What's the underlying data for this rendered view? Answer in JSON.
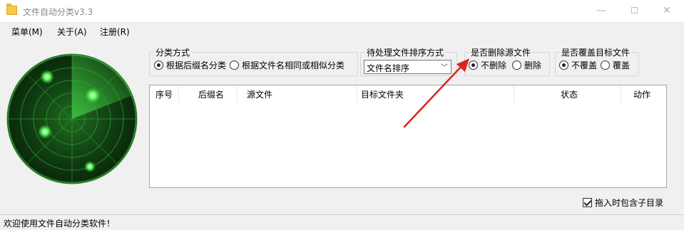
{
  "window": {
    "title": "文件自动分类v3.3",
    "controls": {
      "minimize": "—",
      "close": "✕"
    }
  },
  "menubar": {
    "items": [
      {
        "label": "菜单(M)"
      },
      {
        "label": "关于(A)"
      },
      {
        "label": "注册(R)"
      }
    ]
  },
  "classify": {
    "legend": "分类方式",
    "options": [
      {
        "label": "根据后缀名分类",
        "selected": true
      },
      {
        "label": "根据文件名相同或相似分类",
        "selected": false
      }
    ]
  },
  "sort": {
    "legend": "待处理文件排序方式",
    "selected": "文件名排序"
  },
  "delete_source": {
    "legend": "是否删除源文件",
    "options": [
      {
        "label": "不删除",
        "selected": true
      },
      {
        "label": "删除",
        "selected": false
      }
    ]
  },
  "overwrite": {
    "legend": "是否覆盖目标文件",
    "options": [
      {
        "label": "不覆盖",
        "selected": true
      },
      {
        "label": "覆盖",
        "selected": false
      }
    ]
  },
  "table": {
    "columns": [
      "序号",
      "后缀名",
      "源文件",
      "目标文件夹",
      "状态",
      "动作"
    ],
    "rows": []
  },
  "include_subdirs": {
    "label": "拖入时包含子目录",
    "checked": true
  },
  "statusbar": {
    "text": "欢迎使用文件自动分类软件！"
  },
  "colors": {
    "radar_green": "#33dd33",
    "arrow_red": "#d9261c"
  }
}
